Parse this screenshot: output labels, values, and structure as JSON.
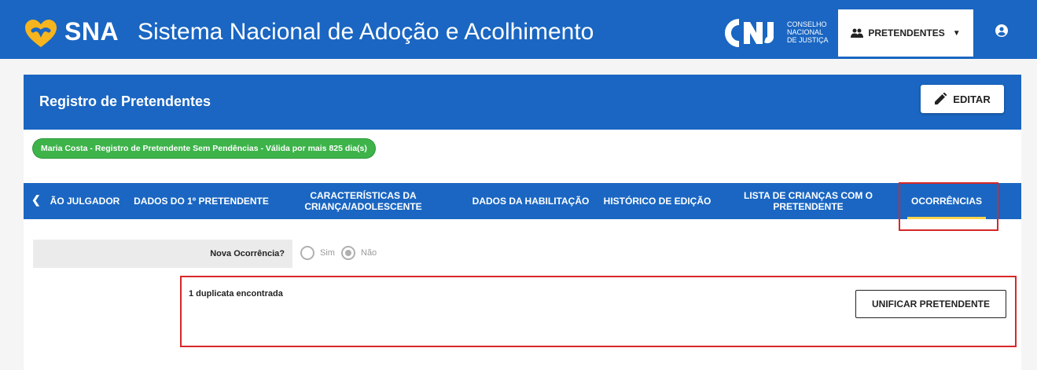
{
  "header": {
    "brand": "SNA",
    "title": "Sistema Nacional de Adoção e Acolhimento",
    "cnj_logo": "CNJ",
    "cnj_text": [
      "CONSELHO",
      "NACIONAL",
      "DE JUSTIÇA"
    ],
    "menu_label": "PRETENDENTES",
    "menu_icon": "people-icon",
    "user_icon": "account-circle-icon",
    "brand_color": "#1a66c2",
    "logo_color": "#f6b51e"
  },
  "card": {
    "title": "Registro de Pretendentes",
    "edit_label": "EDITAR",
    "status_badge": "Maria Costa - Registro de Pretendente Sem Pendências - Válida por mais 825 dia(s)",
    "status_color": "#3db34a"
  },
  "tabs": [
    {
      "label": "ÃO JULGADOR"
    },
    {
      "label": "DADOS DO 1º PRETENDENTE"
    },
    {
      "label": "CARACTERÍSTICAS DA CRIANÇA/ADOLESCENTE"
    },
    {
      "label": "DADOS DA HABILITAÇÃO"
    },
    {
      "label": "HISTÓRICO DE EDIÇÃO"
    },
    {
      "label": "LISTA DE CRIANÇAS COM O PRETENDENTE"
    },
    {
      "label": "OCORRÊNCIAS",
      "active": true
    }
  ],
  "form": {
    "question": "Nova Ocorrência?",
    "option_yes": "Sim",
    "option_no": "Não",
    "selected": "Não"
  },
  "duplicates": {
    "message": "1 duplicata encontrada",
    "unify_label": "UNIFICAR PRETENDENTE"
  },
  "annotation_color": "#d62828"
}
